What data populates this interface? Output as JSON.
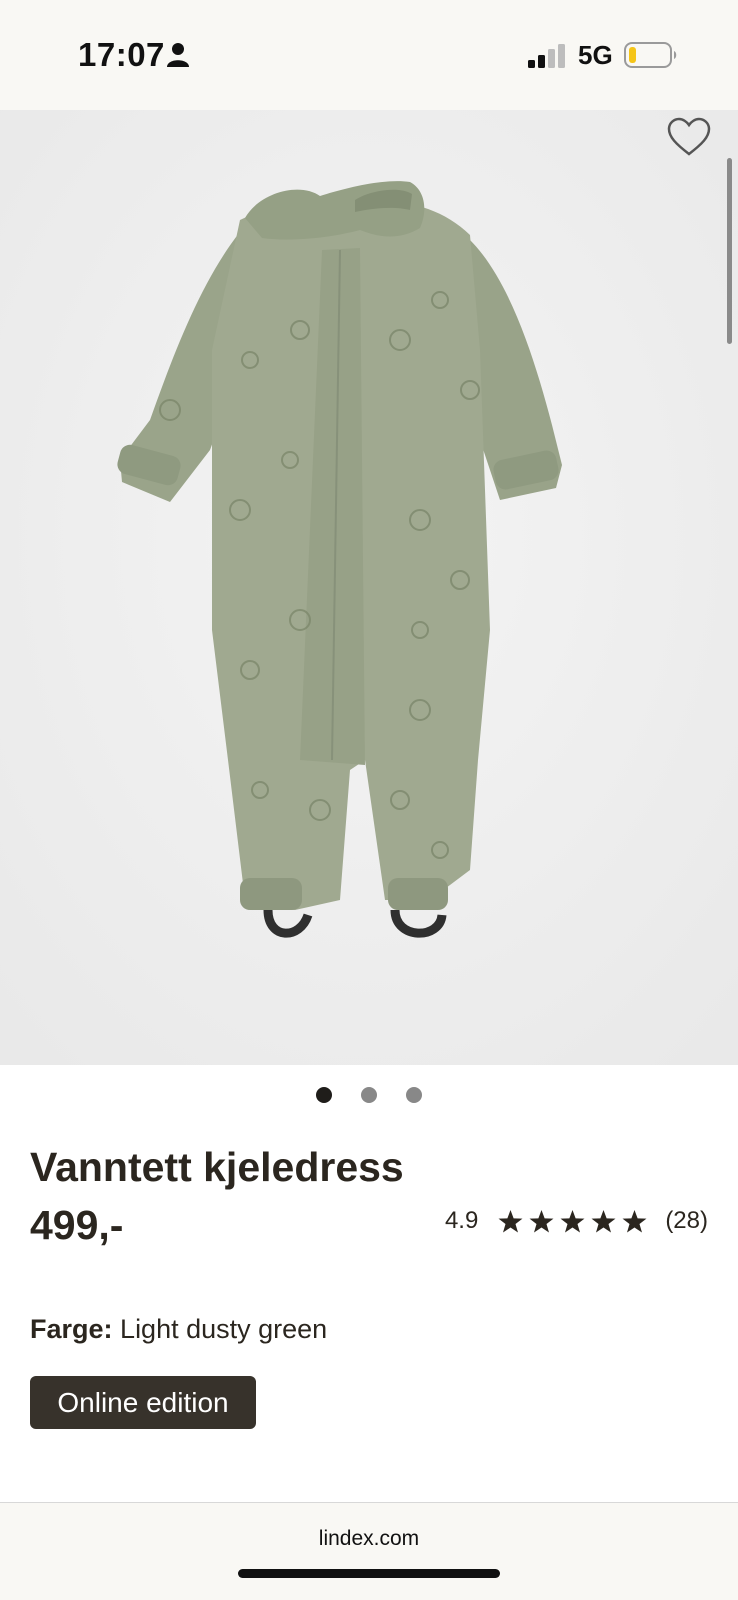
{
  "status_bar": {
    "time": "17:07",
    "network": "5G",
    "icons": [
      "person-icon",
      "signal-icon",
      "battery-icon"
    ],
    "battery_color": "#f5c518"
  },
  "gallery": {
    "image_subject": "green children's rain overall",
    "dots": [
      {
        "active": true
      },
      {
        "active": false
      },
      {
        "active": false
      }
    ],
    "wishlist_icon": "heart-icon"
  },
  "product": {
    "title": "Vanntett kjeledress",
    "price": "499,-",
    "rating": {
      "value": "4.9",
      "stars": 5,
      "count": "(28)"
    },
    "color_label": "Farge:",
    "color_value": "Light dusty green",
    "badge": "Online edition"
  },
  "browser": {
    "url": "lindex.com"
  },
  "colors": {
    "text": "#2b261f",
    "badge_bg": "#37322b",
    "garment": "#9ea78e",
    "background": "#efefef"
  }
}
